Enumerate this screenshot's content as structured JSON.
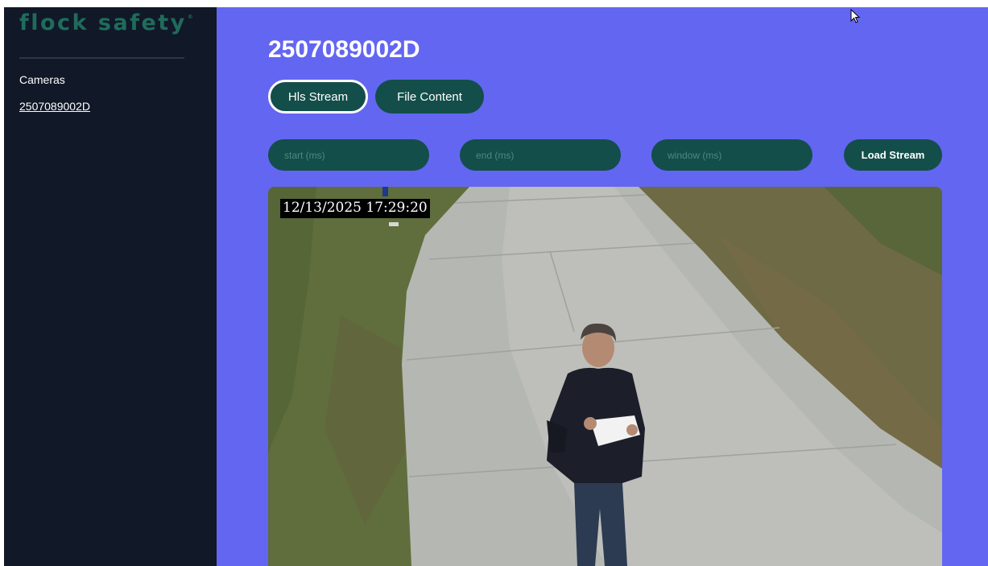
{
  "sidebar": {
    "logo": "flock safety",
    "logo_mark": "®",
    "nav_heading": "Cameras",
    "nav_items": [
      {
        "label": "2507089002D"
      }
    ]
  },
  "main": {
    "title": "2507089002D",
    "tabs": [
      {
        "label": "Hls Stream",
        "active": true
      },
      {
        "label": "File Content",
        "active": false
      }
    ],
    "inputs": {
      "start": {
        "placeholder": "start (ms)",
        "value": ""
      },
      "end": {
        "placeholder": "end (ms)",
        "value": ""
      },
      "window": {
        "placeholder": "window (ms)",
        "value": ""
      }
    },
    "load_button": "Load Stream",
    "video": {
      "timestamp": "12/13/2025 17:29:20"
    }
  },
  "colors": {
    "sidebar_bg": "#111827",
    "main_bg": "#6366f1",
    "control_bg": "#134e4a",
    "brand": "#1f6b5c"
  },
  "icons": {
    "cursor": "mouse-pointer-icon"
  }
}
